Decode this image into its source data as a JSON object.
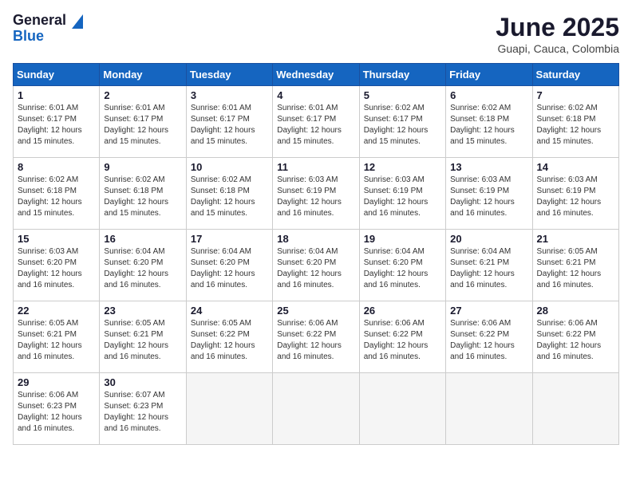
{
  "logo": {
    "general": "General",
    "blue": "Blue"
  },
  "header": {
    "month": "June 2025",
    "location": "Guapi, Cauca, Colombia"
  },
  "weekdays": [
    "Sunday",
    "Monday",
    "Tuesday",
    "Wednesday",
    "Thursday",
    "Friday",
    "Saturday"
  ],
  "weeks": [
    [
      {
        "day": "1",
        "info": "Sunrise: 6:01 AM\nSunset: 6:17 PM\nDaylight: 12 hours\nand 15 minutes."
      },
      {
        "day": "2",
        "info": "Sunrise: 6:01 AM\nSunset: 6:17 PM\nDaylight: 12 hours\nand 15 minutes."
      },
      {
        "day": "3",
        "info": "Sunrise: 6:01 AM\nSunset: 6:17 PM\nDaylight: 12 hours\nand 15 minutes."
      },
      {
        "day": "4",
        "info": "Sunrise: 6:01 AM\nSunset: 6:17 PM\nDaylight: 12 hours\nand 15 minutes."
      },
      {
        "day": "5",
        "info": "Sunrise: 6:02 AM\nSunset: 6:17 PM\nDaylight: 12 hours\nand 15 minutes."
      },
      {
        "day": "6",
        "info": "Sunrise: 6:02 AM\nSunset: 6:18 PM\nDaylight: 12 hours\nand 15 minutes."
      },
      {
        "day": "7",
        "info": "Sunrise: 6:02 AM\nSunset: 6:18 PM\nDaylight: 12 hours\nand 15 minutes."
      }
    ],
    [
      {
        "day": "8",
        "info": "Sunrise: 6:02 AM\nSunset: 6:18 PM\nDaylight: 12 hours\nand 15 minutes."
      },
      {
        "day": "9",
        "info": "Sunrise: 6:02 AM\nSunset: 6:18 PM\nDaylight: 12 hours\nand 15 minutes."
      },
      {
        "day": "10",
        "info": "Sunrise: 6:02 AM\nSunset: 6:18 PM\nDaylight: 12 hours\nand 15 minutes."
      },
      {
        "day": "11",
        "info": "Sunrise: 6:03 AM\nSunset: 6:19 PM\nDaylight: 12 hours\nand 16 minutes."
      },
      {
        "day": "12",
        "info": "Sunrise: 6:03 AM\nSunset: 6:19 PM\nDaylight: 12 hours\nand 16 minutes."
      },
      {
        "day": "13",
        "info": "Sunrise: 6:03 AM\nSunset: 6:19 PM\nDaylight: 12 hours\nand 16 minutes."
      },
      {
        "day": "14",
        "info": "Sunrise: 6:03 AM\nSunset: 6:19 PM\nDaylight: 12 hours\nand 16 minutes."
      }
    ],
    [
      {
        "day": "15",
        "info": "Sunrise: 6:03 AM\nSunset: 6:20 PM\nDaylight: 12 hours\nand 16 minutes."
      },
      {
        "day": "16",
        "info": "Sunrise: 6:04 AM\nSunset: 6:20 PM\nDaylight: 12 hours\nand 16 minutes."
      },
      {
        "day": "17",
        "info": "Sunrise: 6:04 AM\nSunset: 6:20 PM\nDaylight: 12 hours\nand 16 minutes."
      },
      {
        "day": "18",
        "info": "Sunrise: 6:04 AM\nSunset: 6:20 PM\nDaylight: 12 hours\nand 16 minutes."
      },
      {
        "day": "19",
        "info": "Sunrise: 6:04 AM\nSunset: 6:20 PM\nDaylight: 12 hours\nand 16 minutes."
      },
      {
        "day": "20",
        "info": "Sunrise: 6:04 AM\nSunset: 6:21 PM\nDaylight: 12 hours\nand 16 minutes."
      },
      {
        "day": "21",
        "info": "Sunrise: 6:05 AM\nSunset: 6:21 PM\nDaylight: 12 hours\nand 16 minutes."
      }
    ],
    [
      {
        "day": "22",
        "info": "Sunrise: 6:05 AM\nSunset: 6:21 PM\nDaylight: 12 hours\nand 16 minutes."
      },
      {
        "day": "23",
        "info": "Sunrise: 6:05 AM\nSunset: 6:21 PM\nDaylight: 12 hours\nand 16 minutes."
      },
      {
        "day": "24",
        "info": "Sunrise: 6:05 AM\nSunset: 6:22 PM\nDaylight: 12 hours\nand 16 minutes."
      },
      {
        "day": "25",
        "info": "Sunrise: 6:06 AM\nSunset: 6:22 PM\nDaylight: 12 hours\nand 16 minutes."
      },
      {
        "day": "26",
        "info": "Sunrise: 6:06 AM\nSunset: 6:22 PM\nDaylight: 12 hours\nand 16 minutes."
      },
      {
        "day": "27",
        "info": "Sunrise: 6:06 AM\nSunset: 6:22 PM\nDaylight: 12 hours\nand 16 minutes."
      },
      {
        "day": "28",
        "info": "Sunrise: 6:06 AM\nSunset: 6:22 PM\nDaylight: 12 hours\nand 16 minutes."
      }
    ],
    [
      {
        "day": "29",
        "info": "Sunrise: 6:06 AM\nSunset: 6:23 PM\nDaylight: 12 hours\nand 16 minutes."
      },
      {
        "day": "30",
        "info": "Sunrise: 6:07 AM\nSunset: 6:23 PM\nDaylight: 12 hours\nand 16 minutes."
      },
      {
        "day": "",
        "info": ""
      },
      {
        "day": "",
        "info": ""
      },
      {
        "day": "",
        "info": ""
      },
      {
        "day": "",
        "info": ""
      },
      {
        "day": "",
        "info": ""
      }
    ]
  ]
}
